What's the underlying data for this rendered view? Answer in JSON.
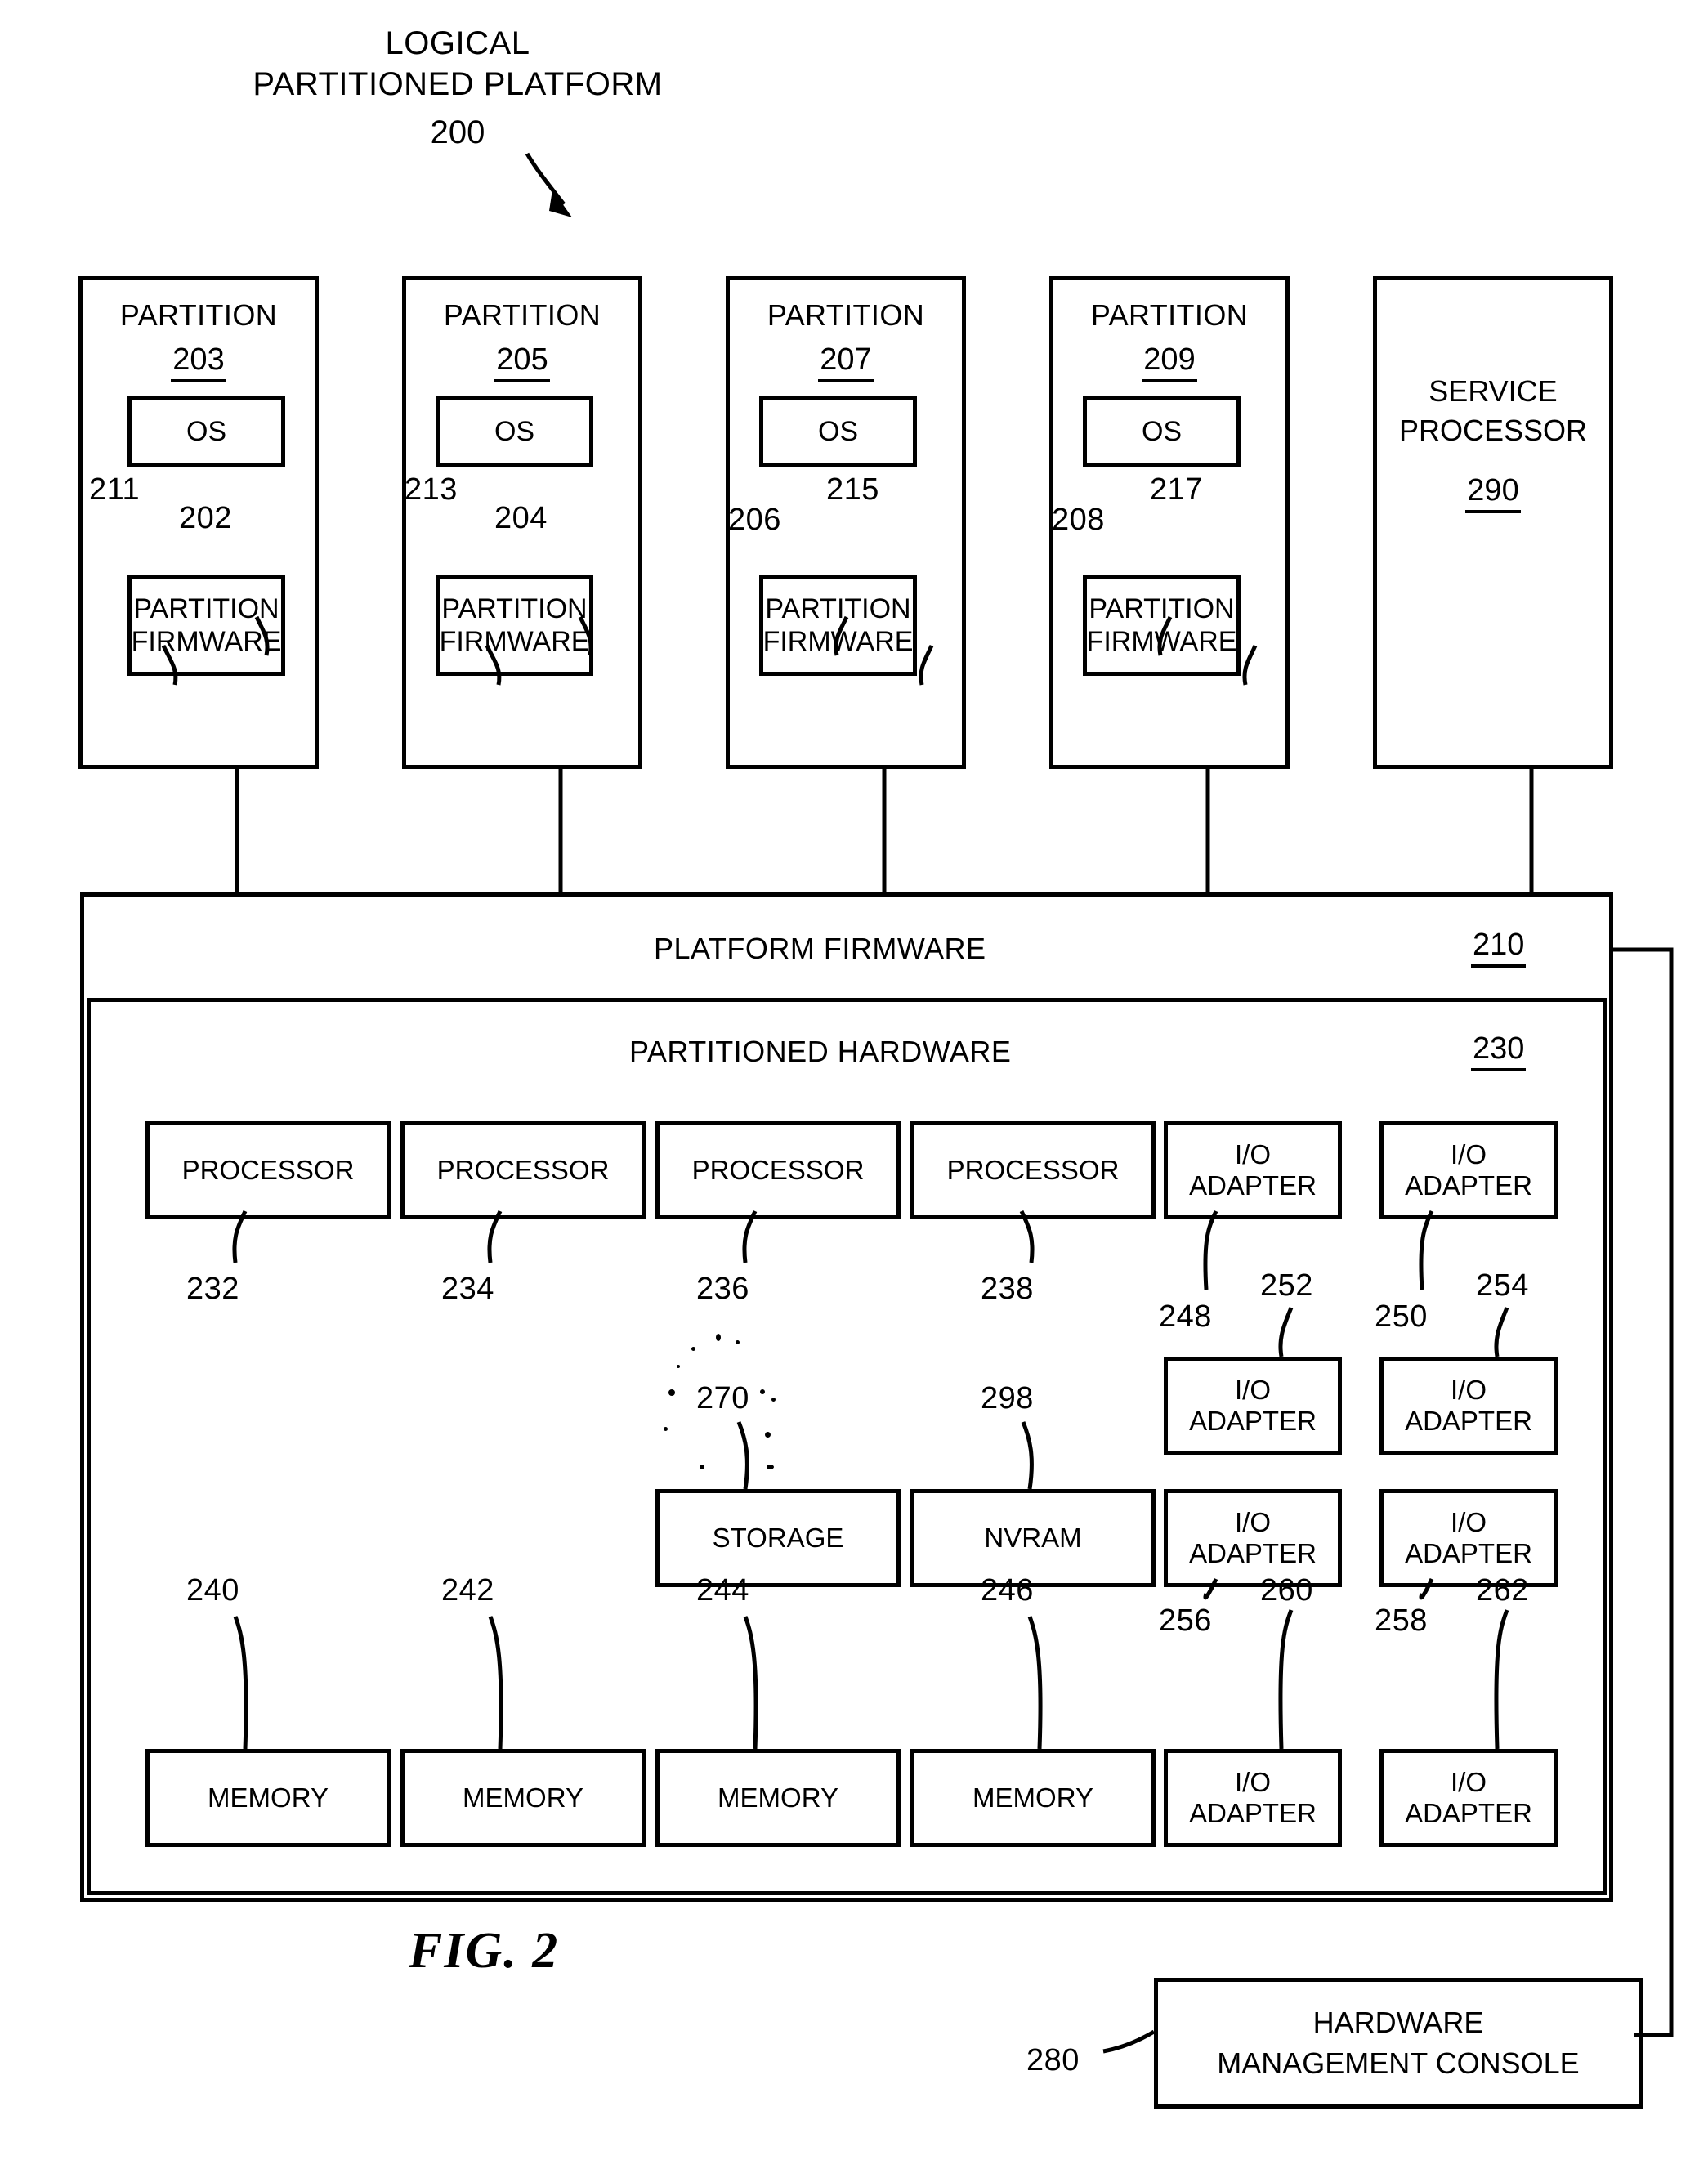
{
  "figure": {
    "title": "LOGICAL\nPARTITIONED PLATFORM",
    "title_ref": "200",
    "caption": "FIG. 2"
  },
  "partitions": [
    {
      "label": "PARTITION",
      "ref": "203",
      "os_label": "OS",
      "firmware_label": "PARTITION\nFIRMWARE",
      "left_ref": "211",
      "right_ref": "202"
    },
    {
      "label": "PARTITION",
      "ref": "205",
      "os_label": "OS",
      "firmware_label": "PARTITION\nFIRMWARE",
      "left_ref": "213",
      "right_ref": "204"
    },
    {
      "label": "PARTITION",
      "ref": "207",
      "os_label": "OS",
      "firmware_label": "PARTITION\nFIRMWARE",
      "left_ref": "206",
      "right_ref": "215"
    },
    {
      "label": "PARTITION",
      "ref": "209",
      "os_label": "OS",
      "firmware_label": "PARTITION\nFIRMWARE",
      "left_ref": "208",
      "right_ref": "217"
    }
  ],
  "service_processor": {
    "label": "SERVICE\nPROCESSOR",
    "ref": "290"
  },
  "platform_firmware": {
    "label": "PLATFORM FIRMWARE",
    "ref": "210"
  },
  "partitioned_hardware": {
    "label": "PARTITIONED HARDWARE",
    "ref": "230"
  },
  "processors": [
    {
      "label": "PROCESSOR",
      "ref": "232"
    },
    {
      "label": "PROCESSOR",
      "ref": "234"
    },
    {
      "label": "PROCESSOR",
      "ref": "236"
    },
    {
      "label": "PROCESSOR",
      "ref": "238"
    }
  ],
  "storage": {
    "label": "STORAGE",
    "ref": "270"
  },
  "nvram": {
    "label": "NVRAM",
    "ref": "298"
  },
  "memories": [
    {
      "label": "MEMORY",
      "ref": "240"
    },
    {
      "label": "MEMORY",
      "ref": "242"
    },
    {
      "label": "MEMORY",
      "ref": "244"
    },
    {
      "label": "MEMORY",
      "ref": "246"
    }
  ],
  "io_adapters": [
    {
      "label": "I/O\nADAPTER",
      "ref": "248"
    },
    {
      "label": "I/O\nADAPTER",
      "ref": "250"
    },
    {
      "label": "I/O\nADAPTER",
      "ref": "252"
    },
    {
      "label": "I/O\nADAPTER",
      "ref": "254"
    },
    {
      "label": "I/O\nADAPTER",
      "ref": "256"
    },
    {
      "label": "I/O\nADAPTER",
      "ref": "258"
    },
    {
      "label": "I/O\nADAPTER",
      "ref": "260"
    },
    {
      "label": "I/O\nADAPTER",
      "ref": "262"
    }
  ],
  "hardware_management_console": {
    "label": "HARDWARE\nMANAGEMENT CONSOLE",
    "ref": "280"
  }
}
